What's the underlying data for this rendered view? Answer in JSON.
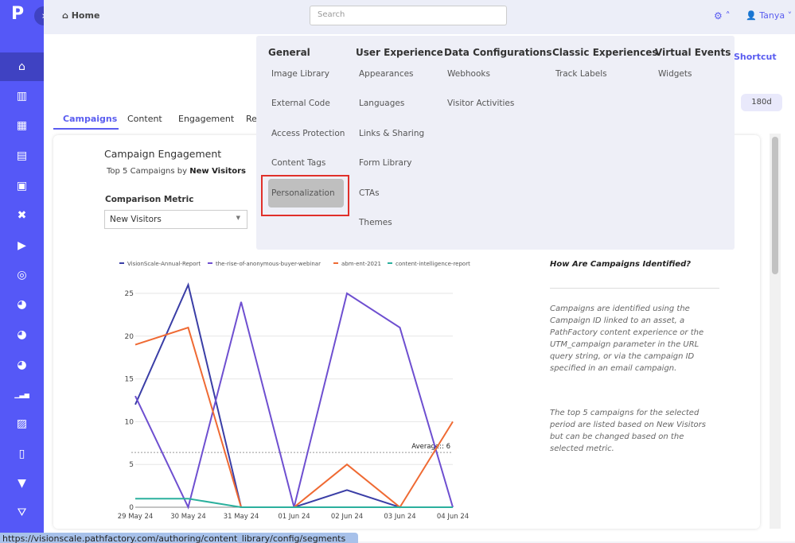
{
  "header": {
    "home": "Home",
    "search_placeholder": "Search",
    "user": "Tanya"
  },
  "sidebar": {
    "icons": [
      "home-icon",
      "library-icon",
      "dashboard-icon",
      "grid-icon",
      "browser-icon",
      "tools-icon",
      "tv-icon",
      "target-icon",
      "thumb-icon",
      "thumb-icon",
      "thumb-icon",
      "bar-chart-icon",
      "chart-add-icon",
      "clipboard-clock-icon",
      "bookmark-icon",
      "filter-dollar-icon"
    ],
    "active": 0
  },
  "main": {
    "shortcut": "Shortcut",
    "range_180": "180d",
    "tabs": [
      "Campaigns",
      "Content",
      "Engagement",
      "Re"
    ],
    "active_tab": 0
  },
  "card": {
    "title": "Campaign Engagement",
    "subtitle_prefix": "Top 5 Campaigns by ",
    "subtitle_metric": "New Visitors",
    "metric_label": "Comparison Metric",
    "metric_value": "New Visitors",
    "info_title": "How Are Campaigns Identified?",
    "info_p1": "Campaigns are identified using the Campaign ID linked to an asset, a PathFactory content experience or the UTM_campaign parameter in the URL query string, or via the campaign ID specified in an email campaign.",
    "info_p2": "The top 5 campaigns for the selected period are listed based on New Visitors but can be changed based on the selected metric."
  },
  "mega_menu": {
    "columns": [
      {
        "title": "General",
        "items": [
          "Image Library",
          "External Code",
          "Access Protection",
          "Content Tags",
          "Personalization"
        ]
      },
      {
        "title": "User Experience",
        "items": [
          "Appearances",
          "Languages",
          "Links & Sharing",
          "Form Library",
          "CTAs",
          "Themes"
        ]
      },
      {
        "title": "Data Configurations",
        "items": [
          "Webhooks",
          "Visitor Activities"
        ]
      },
      {
        "title": "Classic Experiences",
        "items": [
          "Track Labels"
        ]
      },
      {
        "title": "Virtual Events",
        "items": [
          "Widgets"
        ]
      }
    ],
    "highlighted": "Personalization"
  },
  "status_url": "https://visionscale.pathfactory.com/authoring/content_library/config/segments",
  "chart_data": {
    "type": "line",
    "x": [
      "29 May 24",
      "30 May 24",
      "31 May 24",
      "01 Jun 24",
      "02 Jun 24",
      "03 Jun 24",
      "04 Jun 24"
    ],
    "ylim": [
      0,
      25
    ],
    "yticks": [
      0,
      5,
      10,
      15,
      20,
      25
    ],
    "grid": true,
    "legend": "top",
    "series": [
      {
        "name": "VisionScale-Annual-Report",
        "color": "#3a3ea6",
        "values": [
          12,
          26,
          0,
          0,
          2,
          0,
          0
        ]
      },
      {
        "name": "the-rise-of-anonymous-buyer-webinar",
        "color": "#6e4fd0",
        "values": [
          13,
          0,
          24,
          0,
          25,
          21,
          0
        ]
      },
      {
        "name": "abm-ent-2021",
        "color": "#ef6a33",
        "values": [
          19,
          21,
          0,
          0,
          5,
          0,
          10
        ]
      },
      {
        "name": "content-intelligence-report",
        "color": "#2bb09d",
        "values": [
          1,
          1,
          0,
          0,
          0,
          0,
          0
        ]
      }
    ],
    "average": {
      "label": "Average:: 6",
      "value": 6.4
    }
  }
}
